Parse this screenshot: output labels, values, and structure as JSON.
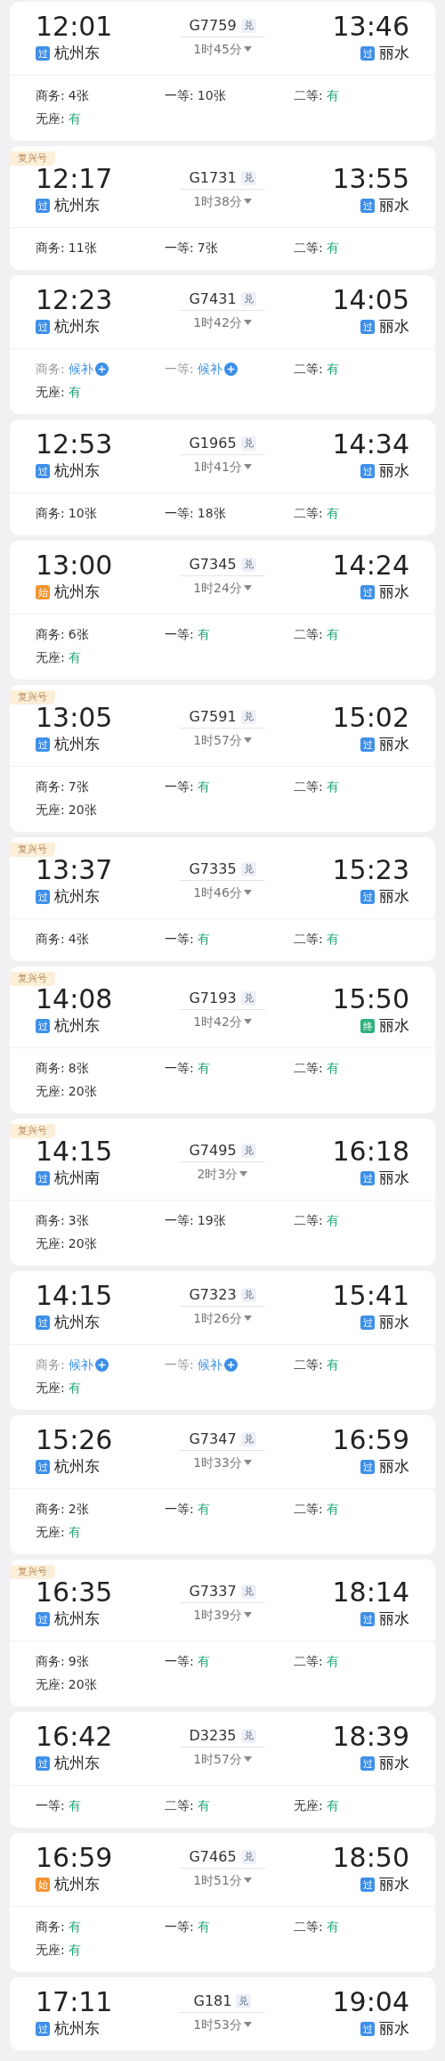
{
  "trains": [
    {
      "depart": "12:01",
      "from_badge": {
        "text": "过",
        "kind": "pass"
      },
      "from": "杭州东",
      "train_no": "G7759",
      "exchange": "兑",
      "duration": "1时45分",
      "arrive": "13:46",
      "to_badge": {
        "text": "过",
        "kind": "pass"
      },
      "to": "丽水",
      "seats": [
        {
          "label": "商务:",
          "value": "4张",
          "kind": "count"
        },
        {
          "label": "一等:",
          "value": "10张",
          "kind": "count"
        },
        {
          "label": "二等:",
          "value": "有",
          "kind": "available"
        },
        {
          "label": "无座:",
          "value": "有",
          "kind": "available"
        }
      ]
    },
    {
      "tag": "复兴号",
      "depart": "12:17",
      "from_badge": {
        "text": "过",
        "kind": "pass"
      },
      "from": "杭州东",
      "train_no": "G1731",
      "exchange": "兑",
      "duration": "1时38分",
      "arrive": "13:55",
      "to_badge": {
        "text": "过",
        "kind": "pass"
      },
      "to": "丽水",
      "seats": [
        {
          "label": "商务:",
          "value": "11张",
          "kind": "count"
        },
        {
          "label": "一等:",
          "value": "7张",
          "kind": "count"
        },
        {
          "label": "二等:",
          "value": "有",
          "kind": "available"
        }
      ]
    },
    {
      "depart": "12:23",
      "from_badge": {
        "text": "过",
        "kind": "pass"
      },
      "from": "杭州东",
      "train_no": "G7431",
      "exchange": "兑",
      "duration": "1时42分",
      "arrive": "14:05",
      "to_badge": {
        "text": "过",
        "kind": "pass"
      },
      "to": "丽水",
      "seats": [
        {
          "label": "商务:",
          "value": "候补",
          "kind": "waitlist"
        },
        {
          "label": "一等:",
          "value": "候补",
          "kind": "waitlist"
        },
        {
          "label": "二等:",
          "value": "有",
          "kind": "available"
        },
        {
          "label": "无座:",
          "value": "有",
          "kind": "available"
        }
      ]
    },
    {
      "depart": "12:53",
      "from_badge": {
        "text": "过",
        "kind": "pass"
      },
      "from": "杭州东",
      "train_no": "G1965",
      "exchange": "兑",
      "duration": "1时41分",
      "arrive": "14:34",
      "to_badge": {
        "text": "过",
        "kind": "pass"
      },
      "to": "丽水",
      "seats": [
        {
          "label": "商务:",
          "value": "10张",
          "kind": "count"
        },
        {
          "label": "一等:",
          "value": "18张",
          "kind": "count"
        },
        {
          "label": "二等:",
          "value": "有",
          "kind": "available"
        }
      ]
    },
    {
      "depart": "13:00",
      "from_badge": {
        "text": "始",
        "kind": "start"
      },
      "from": "杭州东",
      "train_no": "G7345",
      "exchange": "兑",
      "duration": "1时24分",
      "arrive": "14:24",
      "to_badge": {
        "text": "过",
        "kind": "pass"
      },
      "to": "丽水",
      "seats": [
        {
          "label": "商务:",
          "value": "6张",
          "kind": "count"
        },
        {
          "label": "一等:",
          "value": "有",
          "kind": "available"
        },
        {
          "label": "二等:",
          "value": "有",
          "kind": "available"
        },
        {
          "label": "无座:",
          "value": "有",
          "kind": "available"
        }
      ]
    },
    {
      "tag": "复兴号",
      "depart": "13:05",
      "from_badge": {
        "text": "过",
        "kind": "pass"
      },
      "from": "杭州东",
      "train_no": "G7591",
      "exchange": "兑",
      "duration": "1时57分",
      "arrive": "15:02",
      "to_badge": {
        "text": "过",
        "kind": "pass"
      },
      "to": "丽水",
      "seats": [
        {
          "label": "商务:",
          "value": "7张",
          "kind": "count"
        },
        {
          "label": "一等:",
          "value": "有",
          "kind": "available"
        },
        {
          "label": "二等:",
          "value": "有",
          "kind": "available"
        },
        {
          "label": "无座:",
          "value": "20张",
          "kind": "count"
        }
      ]
    },
    {
      "tag": "复兴号",
      "depart": "13:37",
      "from_badge": {
        "text": "过",
        "kind": "pass"
      },
      "from": "杭州东",
      "train_no": "G7335",
      "exchange": "兑",
      "duration": "1时46分",
      "arrive": "15:23",
      "to_badge": {
        "text": "过",
        "kind": "pass"
      },
      "to": "丽水",
      "seats": [
        {
          "label": "商务:",
          "value": "4张",
          "kind": "count"
        },
        {
          "label": "一等:",
          "value": "有",
          "kind": "available"
        },
        {
          "label": "二等:",
          "value": "有",
          "kind": "available"
        }
      ]
    },
    {
      "tag": "复兴号",
      "depart": "14:08",
      "from_badge": {
        "text": "过",
        "kind": "pass"
      },
      "from": "杭州东",
      "train_no": "G7193",
      "exchange": "兑",
      "duration": "1时42分",
      "arrive": "15:50",
      "to_badge": {
        "text": "终",
        "kind": "end"
      },
      "to": "丽水",
      "seats": [
        {
          "label": "商务:",
          "value": "8张",
          "kind": "count"
        },
        {
          "label": "一等:",
          "value": "有",
          "kind": "available"
        },
        {
          "label": "二等:",
          "value": "有",
          "kind": "available"
        },
        {
          "label": "无座:",
          "value": "20张",
          "kind": "count"
        }
      ]
    },
    {
      "tag": "复兴号",
      "depart": "14:15",
      "from_badge": {
        "text": "过",
        "kind": "pass"
      },
      "from": "杭州南",
      "train_no": "G7495",
      "exchange": "兑",
      "duration": "2时3分",
      "arrive": "16:18",
      "to_badge": {
        "text": "过",
        "kind": "pass"
      },
      "to": "丽水",
      "seats": [
        {
          "label": "商务:",
          "value": "3张",
          "kind": "count"
        },
        {
          "label": "一等:",
          "value": "19张",
          "kind": "count"
        },
        {
          "label": "二等:",
          "value": "有",
          "kind": "available"
        },
        {
          "label": "无座:",
          "value": "20张",
          "kind": "count"
        }
      ]
    },
    {
      "depart": "14:15",
      "from_badge": {
        "text": "过",
        "kind": "pass"
      },
      "from": "杭州东",
      "train_no": "G7323",
      "exchange": "兑",
      "duration": "1时26分",
      "arrive": "15:41",
      "to_badge": {
        "text": "过",
        "kind": "pass"
      },
      "to": "丽水",
      "seats": [
        {
          "label": "商务:",
          "value": "候补",
          "kind": "waitlist"
        },
        {
          "label": "一等:",
          "value": "候补",
          "kind": "waitlist"
        },
        {
          "label": "二等:",
          "value": "有",
          "kind": "available"
        },
        {
          "label": "无座:",
          "value": "有",
          "kind": "available"
        }
      ]
    },
    {
      "depart": "15:26",
      "from_badge": {
        "text": "过",
        "kind": "pass"
      },
      "from": "杭州东",
      "train_no": "G7347",
      "exchange": "兑",
      "duration": "1时33分",
      "arrive": "16:59",
      "to_badge": {
        "text": "过",
        "kind": "pass"
      },
      "to": "丽水",
      "seats": [
        {
          "label": "商务:",
          "value": "2张",
          "kind": "count"
        },
        {
          "label": "一等:",
          "value": "有",
          "kind": "available"
        },
        {
          "label": "二等:",
          "value": "有",
          "kind": "available"
        },
        {
          "label": "无座:",
          "value": "有",
          "kind": "available"
        }
      ]
    },
    {
      "tag": "复兴号",
      "depart": "16:35",
      "from_badge": {
        "text": "过",
        "kind": "pass"
      },
      "from": "杭州东",
      "train_no": "G7337",
      "exchange": "兑",
      "duration": "1时39分",
      "arrive": "18:14",
      "to_badge": {
        "text": "过",
        "kind": "pass"
      },
      "to": "丽水",
      "seats": [
        {
          "label": "商务:",
          "value": "9张",
          "kind": "count"
        },
        {
          "label": "一等:",
          "value": "有",
          "kind": "available"
        },
        {
          "label": "二等:",
          "value": "有",
          "kind": "available"
        },
        {
          "label": "无座:",
          "value": "20张",
          "kind": "count"
        }
      ]
    },
    {
      "depart": "16:42",
      "from_badge": {
        "text": "过",
        "kind": "pass"
      },
      "from": "杭州东",
      "train_no": "D3235",
      "exchange": "兑",
      "duration": "1时57分",
      "arrive": "18:39",
      "to_badge": {
        "text": "过",
        "kind": "pass"
      },
      "to": "丽水",
      "seats": [
        {
          "label": "一等:",
          "value": "有",
          "kind": "available"
        },
        {
          "label": "二等:",
          "value": "有",
          "kind": "available"
        },
        {
          "label": "无座:",
          "value": "有",
          "kind": "available"
        }
      ]
    },
    {
      "depart": "16:59",
      "from_badge": {
        "text": "始",
        "kind": "start"
      },
      "from": "杭州东",
      "train_no": "G7465",
      "exchange": "兑",
      "duration": "1时51分",
      "arrive": "18:50",
      "to_badge": {
        "text": "过",
        "kind": "pass"
      },
      "to": "丽水",
      "seats": [
        {
          "label": "商务:",
          "value": "有",
          "kind": "available"
        },
        {
          "label": "一等:",
          "value": "有",
          "kind": "available"
        },
        {
          "label": "二等:",
          "value": "有",
          "kind": "available"
        },
        {
          "label": "无座:",
          "value": "有",
          "kind": "available"
        }
      ]
    },
    {
      "depart": "17:11",
      "from_badge": {
        "text": "过",
        "kind": "pass"
      },
      "from": "杭州东",
      "train_no": "G181",
      "exchange": "兑",
      "duration": "1时53分",
      "arrive": "19:04",
      "to_badge": {
        "text": "过",
        "kind": "pass"
      },
      "to": "丽水"
    }
  ]
}
